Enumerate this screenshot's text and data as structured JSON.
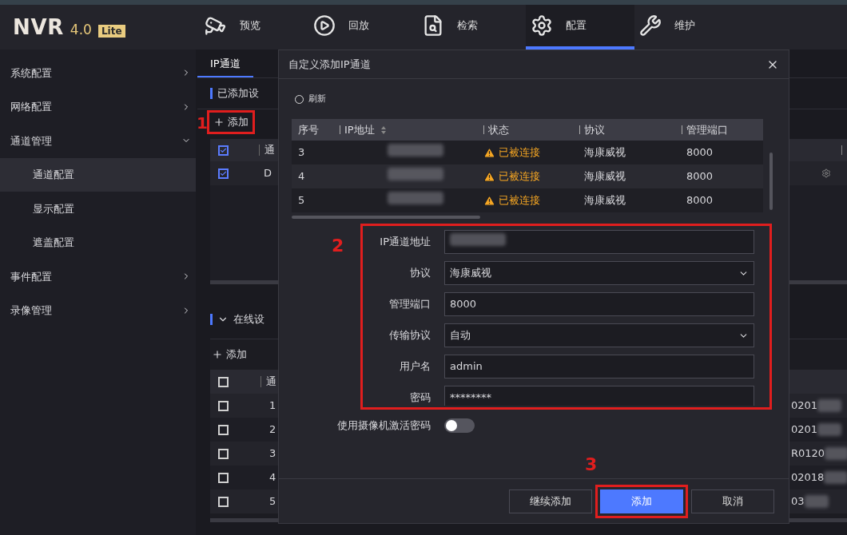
{
  "logo": {
    "name": "NVR",
    "version": "4.0",
    "edition": "Lite"
  },
  "nav": [
    {
      "label": "预览",
      "selected": false
    },
    {
      "label": "回放",
      "selected": false
    },
    {
      "label": "检索",
      "selected": false
    },
    {
      "label": "配置",
      "selected": true
    },
    {
      "label": "维护",
      "selected": false
    }
  ],
  "sidebar": [
    {
      "label": "系统配置",
      "expanded": false
    },
    {
      "label": "网络配置",
      "expanded": false
    },
    {
      "label": "通道管理",
      "expanded": true,
      "children": [
        {
          "label": "通道配置",
          "selected": true
        },
        {
          "label": "显示配置",
          "selected": false
        },
        {
          "label": "遮盖配置",
          "selected": false
        }
      ]
    },
    {
      "label": "事件配置",
      "expanded": false
    },
    {
      "label": "录像管理",
      "expanded": false
    }
  ],
  "page": {
    "tab": {
      "label": "IP通道",
      "selected": true
    },
    "added": {
      "title": "已添加设",
      "add_label": "添加",
      "marker": "1",
      "header": {
        "checked": true,
        "cell": "通"
      },
      "rows": [
        {
          "checked": true,
          "cell": "D"
        }
      ]
    },
    "online": {
      "title": "在线设",
      "expanded": true,
      "add_label": "添加",
      "header": {
        "checked": false,
        "cell": "通"
      },
      "rows": [
        {
          "checked": false,
          "cell": "1",
          "column_3": "0201"
        },
        {
          "checked": false,
          "cell": "2",
          "column_3": "0201"
        },
        {
          "checked": false,
          "cell": "3",
          "column_3": "R0120"
        },
        {
          "checked": false,
          "cell": "4",
          "column_3": "02018"
        },
        {
          "checked": false,
          "cell": "5",
          "column_3": "03"
        }
      ]
    }
  },
  "dialog": {
    "title": "自定义添加IP通道",
    "refresh": "刷新",
    "columns": [
      "序号",
      "IP地址",
      "状态",
      "协议",
      "管理端口"
    ],
    "rows": [
      {
        "index": "3",
        "status": "已被连接",
        "warning": true,
        "protocol": "海康威视",
        "port": "8000"
      },
      {
        "index": "4",
        "status": "已被连接",
        "warning": true,
        "protocol": "海康威视",
        "port": "8000"
      },
      {
        "index": "5",
        "status": "已被连接",
        "warning": true,
        "protocol": "海康威视",
        "port": "8000"
      }
    ],
    "form": {
      "marker": "2",
      "fields": [
        {
          "label": "IP通道地址",
          "kind": "text",
          "redacted": true
        },
        {
          "label": "协议",
          "kind": "select",
          "value": "海康威视"
        },
        {
          "label": "管理端口",
          "kind": "text",
          "value": "8000"
        },
        {
          "label": "传输协议",
          "kind": "select",
          "value": "自动"
        },
        {
          "label": "用户名",
          "kind": "text",
          "value": "admin"
        },
        {
          "label": "密码",
          "kind": "password",
          "value": "********"
        }
      ]
    },
    "toggle": {
      "label": "使用摄像机激活密码",
      "on": false
    },
    "buttons": [
      {
        "label": "继续添加",
        "primary": false
      },
      {
        "label": "添加",
        "primary": true,
        "marker": "3"
      },
      {
        "label": "取消",
        "primary": false
      }
    ]
  }
}
